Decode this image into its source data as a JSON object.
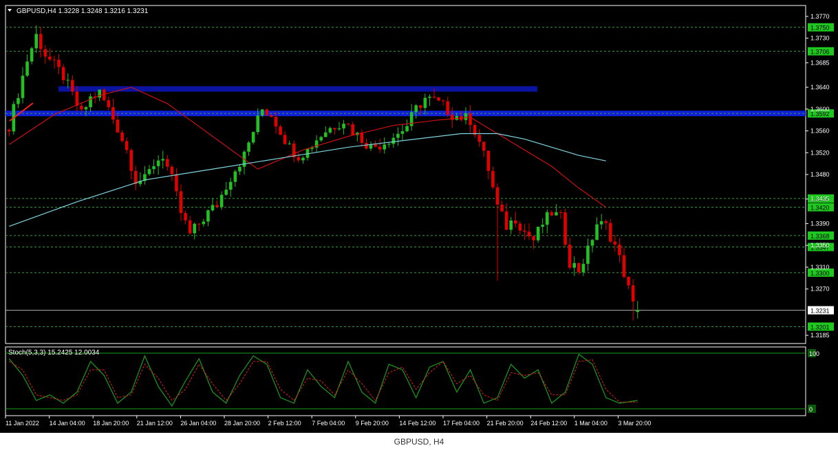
{
  "caption": "GBPUSD, H4",
  "header": {
    "symbol_line": "GBPUSD,H4  1.3228 1.3248 1.3216 1.3231",
    "stoch_line": "Stoch(5,3,3) 15.2425 12.0034"
  },
  "colors": {
    "background": "#000000",
    "bull": "#22c022",
    "bear": "#e00000",
    "ma_fast": "#cc1010",
    "ma_slow": "#7fd6e0",
    "zone": "#0a14a0",
    "level": "#3aa03a",
    "label_bg": "#1ec81e",
    "stoch_main": "#1b9e1b",
    "stoch_signal": "#e02020"
  },
  "chart_data": [
    {
      "type": "candlestick",
      "symbol": "GBPUSD",
      "timeframe": "H4",
      "ohlc_last": {
        "open": 1.3228,
        "high": 1.3248,
        "low": 1.3216,
        "close": 1.3231
      },
      "ylim": [
        1.317,
        1.379
      ],
      "y_ticks": [
        1.377,
        1.373,
        1.3685,
        1.364,
        1.36,
        1.356,
        1.352,
        1.348,
        1.3435,
        1.339,
        1.335,
        1.331,
        1.327,
        1.3185
      ],
      "x_ticks": [
        "11 Jan 2022",
        "14 Jan 04:00",
        "18 Jan 20:00",
        "21 Jan 12:00",
        "26 Jan 04:00",
        "28 Jan 20:00",
        "2 Feb 12:00",
        "7 Feb 04:00",
        "9 Feb 20:00",
        "14 Feb 12:00",
        "17 Feb 04:00",
        "21 Feb 20:00",
        "24 Feb 12:00",
        "1 Mar 04:00",
        "3 Mar 20:00"
      ],
      "price_levels": [
        1.375,
        1.3706,
        1.3592,
        1.3436,
        1.342,
        1.3368,
        1.3347,
        1.33,
        1.3201
      ],
      "current_price": 1.3231,
      "resistance_zone": [
        1.3632,
        1.3642
      ],
      "support_line": 1.3592,
      "close_path": [
        [
          0,
          1.357
        ],
        [
          2,
          1.363
        ],
        [
          4,
          1.369
        ],
        [
          6,
          1.3735
        ],
        [
          8,
          1.37
        ],
        [
          10,
          1.368
        ],
        [
          12,
          1.366
        ],
        [
          14,
          1.3625
        ],
        [
          16,
          1.359
        ],
        [
          18,
          1.362
        ],
        [
          20,
          1.363
        ],
        [
          22,
          1.36
        ],
        [
          24,
          1.3565
        ],
        [
          26,
          1.3525
        ],
        [
          28,
          1.347
        ],
        [
          30,
          1.347
        ],
        [
          32,
          1.35
        ],
        [
          34,
          1.3515
        ],
        [
          36,
          1.347
        ],
        [
          38,
          1.341
        ],
        [
          40,
          1.337
        ],
        [
          42,
          1.339
        ],
        [
          44,
          1.341
        ],
        [
          46,
          1.3425
        ],
        [
          48,
          1.346
        ],
        [
          50,
          1.349
        ],
        [
          52,
          1.3515
        ],
        [
          54,
          1.356
        ],
        [
          56,
          1.36
        ],
        [
          58,
          1.359
        ],
        [
          60,
          1.356
        ],
        [
          62,
          1.353
        ],
        [
          64,
          1.3515
        ],
        [
          66,
          1.3525
        ],
        [
          68,
          1.3545
        ],
        [
          70,
          1.356
        ],
        [
          72,
          1.357
        ],
        [
          74,
          1.358
        ],
        [
          76,
          1.356
        ],
        [
          78,
          1.3545
        ],
        [
          80,
          1.353
        ],
        [
          82,
          1.3535
        ],
        [
          84,
          1.3545
        ],
        [
          86,
          1.3555
        ],
        [
          88,
          1.357
        ],
        [
          90,
          1.36
        ],
        [
          92,
          1.362
        ],
        [
          94,
          1.3615
        ],
        [
          96,
          1.3605
        ],
        [
          98,
          1.359
        ],
        [
          100,
          1.3585
        ],
        [
          102,
          1.358
        ],
        [
          104,
          1.354
        ],
        [
          106,
          1.349
        ],
        [
          108,
          1.342
        ],
        [
          110,
          1.3385
        ],
        [
          112,
          1.34
        ],
        [
          114,
          1.3375
        ],
        [
          116,
          1.336
        ],
        [
          118,
          1.339
        ],
        [
          120,
          1.341
        ],
        [
          122,
          1.34
        ],
        [
          124,
          1.332
        ],
        [
          126,
          1.3305
        ],
        [
          128,
          1.334
        ],
        [
          130,
          1.339
        ],
        [
          132,
          1.3385
        ],
        [
          134,
          1.335
        ],
        [
          136,
          1.33
        ],
        [
          138,
          1.324
        ],
        [
          139,
          1.3231
        ]
      ],
      "wicks": [
        [
          104,
          1.3555,
          1.3535
        ],
        [
          108,
          1.339,
          1.3285
        ],
        [
          138,
          1.325,
          1.3212
        ]
      ],
      "series": [
        {
          "name": "",
          "values": [
            [
              0,
              1.3535
            ],
            [
              10,
              1.359
            ],
            [
              20,
              1.3625
            ],
            [
              27,
              1.364
            ],
            [
              35,
              1.361
            ],
            [
              45,
              1.355
            ],
            [
              55,
              1.349
            ],
            [
              65,
              1.3525
            ],
            [
              75,
              1.355
            ],
            [
              85,
              1.357
            ],
            [
              95,
              1.358
            ],
            [
              102,
              1.3585
            ],
            [
              108,
              1.3555
            ],
            [
              114,
              1.3525
            ],
            [
              120,
              1.3495
            ],
            [
              126,
              1.3455
            ],
            [
              132,
              1.342
            ]
          ]
        },
        {
          "name": "",
          "values": [
            [
              0,
              1.3385
            ],
            [
              15,
              1.343
            ],
            [
              30,
              1.347
            ],
            [
              45,
              1.349
            ],
            [
              60,
              1.351
            ],
            [
              75,
              1.353
            ],
            [
              90,
              1.3545
            ],
            [
              100,
              1.3555
            ],
            [
              108,
              1.3555
            ],
            [
              114,
              1.3545
            ],
            [
              120,
              1.353
            ],
            [
              126,
              1.3515
            ],
            [
              132,
              1.3505
            ]
          ]
        }
      ]
    },
    {
      "type": "line",
      "title": "Stoch(5,3,3)",
      "values_last": {
        "main": 15.2425,
        "signal": 12.0034
      },
      "ylim": [
        0,
        100
      ],
      "y_ticks": [
        100,
        0
      ],
      "levels": [
        100,
        0
      ],
      "series": [
        {
          "name": "",
          "values": [
            [
              0,
              90
            ],
            [
              3,
              60
            ],
            [
              6,
              15
            ],
            [
              9,
              25
            ],
            [
              12,
              10
            ],
            [
              15,
              30
            ],
            [
              18,
              85
            ],
            [
              21,
              60
            ],
            [
              24,
              10
            ],
            [
              27,
              30
            ],
            [
              30,
              95
            ],
            [
              33,
              40
            ],
            [
              36,
              5
            ],
            [
              39,
              50
            ],
            [
              42,
              90
            ],
            [
              45,
              30
            ],
            [
              48,
              10
            ],
            [
              51,
              60
            ],
            [
              54,
              95
            ],
            [
              57,
              80
            ],
            [
              60,
              20
            ],
            [
              63,
              10
            ],
            [
              66,
              70
            ],
            [
              69,
              40
            ],
            [
              72,
              20
            ],
            [
              75,
              85
            ],
            [
              78,
              30
            ],
            [
              81,
              10
            ],
            [
              84,
              80
            ],
            [
              87,
              70
            ],
            [
              90,
              20
            ],
            [
              93,
              75
            ],
            [
              96,
              85
            ],
            [
              99,
              30
            ],
            [
              102,
              70
            ],
            [
              105,
              10
            ],
            [
              108,
              20
            ],
            [
              111,
              80
            ],
            [
              114,
              55
            ],
            [
              117,
              70
            ],
            [
              120,
              10
            ],
            [
              123,
              30
            ],
            [
              126,
              98
            ],
            [
              129,
              80
            ],
            [
              132,
              20
            ],
            [
              135,
              10
            ],
            [
              139,
              15
            ]
          ]
        },
        {
          "name": "",
          "values": [
            [
              0,
              85
            ],
            [
              3,
              70
            ],
            [
              6,
              25
            ],
            [
              9,
              20
            ],
            [
              12,
              15
            ],
            [
              15,
              25
            ],
            [
              18,
              70
            ],
            [
              21,
              70
            ],
            [
              24,
              20
            ],
            [
              27,
              25
            ],
            [
              30,
              80
            ],
            [
              33,
              55
            ],
            [
              36,
              15
            ],
            [
              39,
              35
            ],
            [
              42,
              80
            ],
            [
              45,
              45
            ],
            [
              48,
              15
            ],
            [
              51,
              45
            ],
            [
              54,
              85
            ],
            [
              57,
              85
            ],
            [
              60,
              35
            ],
            [
              63,
              15
            ],
            [
              66,
              55
            ],
            [
              69,
              50
            ],
            [
              72,
              25
            ],
            [
              75,
              70
            ],
            [
              78,
              45
            ],
            [
              81,
              15
            ],
            [
              84,
              65
            ],
            [
              87,
              75
            ],
            [
              90,
              35
            ],
            [
              93,
              65
            ],
            [
              96,
              85
            ],
            [
              99,
              45
            ],
            [
              102,
              60
            ],
            [
              105,
              25
            ],
            [
              108,
              15
            ],
            [
              111,
              65
            ],
            [
              114,
              60
            ],
            [
              117,
              65
            ],
            [
              120,
              25
            ],
            [
              123,
              25
            ],
            [
              126,
              85
            ],
            [
              129,
              88
            ],
            [
              132,
              35
            ],
            [
              135,
              12
            ],
            [
              139,
              12
            ]
          ]
        }
      ]
    }
  ]
}
